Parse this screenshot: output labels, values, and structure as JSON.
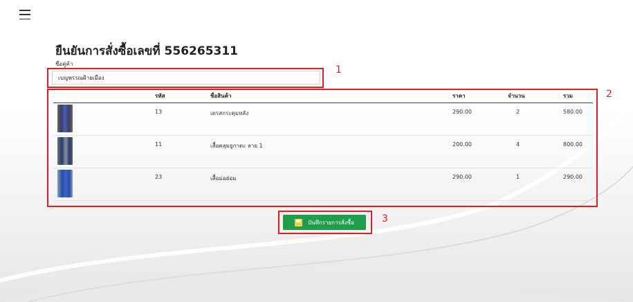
{
  "header": {
    "menu_icon": "hamburger-menu-icon"
  },
  "order": {
    "title_prefix": "ยืนยันการสั่งซื้อเลขที่",
    "number": "556265311",
    "customer_label": "ชื่อคู่ค้า",
    "customer_value": "เบญพรรณฝ้ายเมือง"
  },
  "table": {
    "headers": {
      "image": "",
      "code": "รหัส",
      "name": "ชื่อสินค้า",
      "price": "ราคา",
      "qty": "จำนวน",
      "total": "รวม"
    },
    "rows": [
      {
        "code": "13",
        "name": "เดรสกระดุมหลัง",
        "price": "290.00",
        "qty": "2",
        "total": "580.00"
      },
      {
        "code": "11",
        "name": "เสื้อคลุมยูกาตะ ลาย 1",
        "price": "200.00",
        "qty": "4",
        "total": "800.00"
      },
      {
        "code": "23",
        "name": "เสื้อม่อฮ่อม",
        "price": "290.00",
        "qty": "1",
        "total": "290.00"
      }
    ]
  },
  "actions": {
    "save_label": "บันทึกรายการสั่งซื้อ",
    "save_icon": "save-icon"
  },
  "annotations": {
    "a1": "1",
    "a2": "2",
    "a3": "3"
  },
  "colors": {
    "accent": "#1f9d4a",
    "annotation": "#e02020"
  }
}
